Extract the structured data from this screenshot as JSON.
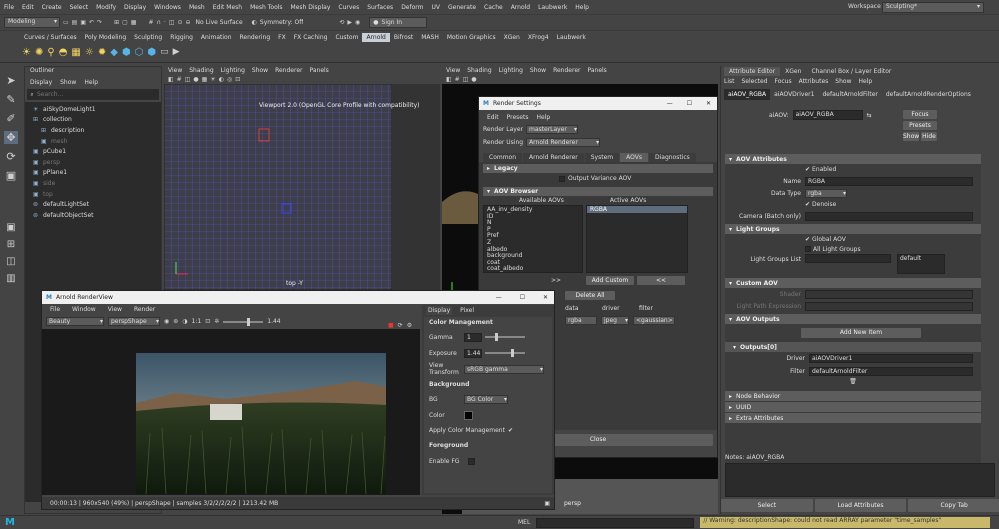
{
  "menubar": {
    "items": [
      "File",
      "Edit",
      "Create",
      "Select",
      "Modify",
      "Display",
      "Windows",
      "Mesh",
      "Edit Mesh",
      "Mesh Tools",
      "Mesh Display",
      "Curves",
      "Surfaces",
      "Deform",
      "UV",
      "Generate",
      "Cache",
      "Arnold",
      "Laubwerk",
      "Help"
    ],
    "workspace_label": "Workspace :",
    "workspace_value": "Sculpting*"
  },
  "statusline": {
    "mode": "Modeling",
    "live_surface": "No Live Surface",
    "symmetry": "Symmetry: Off",
    "sign_in": "Sign In"
  },
  "shelf": {
    "tabs": [
      "Curves / Surfaces",
      "Poly Modeling",
      "Sculpting",
      "Rigging",
      "Animation",
      "Rendering",
      "FX",
      "FX Caching",
      "Custom",
      "Arnold",
      "Bifrost",
      "MASH",
      "Motion Graphics",
      "XGen",
      "XFrog4",
      "Laubwerk"
    ],
    "active": "Arnold"
  },
  "outliner": {
    "title": "Outliner",
    "menus": [
      "Display",
      "Show",
      "Help"
    ],
    "search_placeholder": "Search...",
    "items": [
      {
        "label": "aiSkyDomeLight1",
        "dim": false
      },
      {
        "label": "collection",
        "dim": false
      },
      {
        "label": "description",
        "dim": false
      },
      {
        "label": "mesh",
        "dim": true
      },
      {
        "label": "pCube1",
        "dim": false
      },
      {
        "label": "persp",
        "dim": true
      },
      {
        "label": "pPlane1",
        "dim": false
      },
      {
        "label": "side",
        "dim": true
      },
      {
        "label": "top",
        "dim": true
      },
      {
        "label": "defaultLightSet",
        "dim": false
      },
      {
        "label": "defaultObjectSet",
        "dim": false
      }
    ]
  },
  "viewport_left": {
    "menus": [
      "View",
      "Shading",
      "Lighting",
      "Show",
      "Renderer",
      "Panels"
    ],
    "info": "Viewport 2.0 (OpenGL Core Profile with compatibility)",
    "camera": "top -Y"
  },
  "viewport_right": {
    "menus": [
      "View",
      "Shading",
      "Lighting",
      "Show",
      "Renderer",
      "Panels"
    ],
    "camera": "persp"
  },
  "render_settings": {
    "title": "Render Settings",
    "menus": [
      "Edit",
      "Presets",
      "Help"
    ],
    "render_layer_label": "Render Layer",
    "render_layer_value": "masterLayer",
    "render_using_label": "Render Using",
    "render_using_value": "Arnold Renderer",
    "tabs": [
      "Common",
      "Arnold Renderer",
      "System",
      "AOVs",
      "Diagnostics"
    ],
    "active_tab": "AOVs",
    "legacy": "Legacy",
    "output_variance": "Output Variance AOV",
    "aov_browser": "AOV Browser",
    "available_title": "Available AOVs",
    "active_title": "Active AOVs",
    "available": [
      "AA_inv_density",
      "ID",
      "N",
      "P",
      "Pref",
      "Z",
      "albedo",
      "background",
      "coat",
      "coat_albedo"
    ],
    "active": [
      "RGBA"
    ],
    "add_custom": "Add Custom",
    "remove": "<<",
    "arrows": ">>",
    "delete_all": "Delete All",
    "cols": [
      "data",
      "driver",
      "filter"
    ],
    "row_data": "rgba",
    "row_driver": "jpeg",
    "row_filter": "<gaussian>",
    "close": "Close"
  },
  "renderview": {
    "title": "Arnold RenderView",
    "menus": [
      "File",
      "Window",
      "View",
      "Render"
    ],
    "aov": "Beauty",
    "camera": "perspShape",
    "ratio": "1:1",
    "exposure_value": "1.44",
    "tabs": [
      "Display",
      "Pixel"
    ],
    "status": "00:00:13 | 960x540 (49%) | perspShape | samples 3/2/2/2/2/2 | 1213.42 MB",
    "cm": {
      "section": "Color Management",
      "gamma_label": "Gamma",
      "gamma_value": "1",
      "exposure_label": "Exposure",
      "exposure_value": "1.44",
      "view_transform_label": "View Transform",
      "view_transform_value": "sRGB gamma"
    },
    "bg": {
      "section": "Background",
      "bg_label": "BG",
      "bg_value": "BG Color",
      "color_label": "Color",
      "apply_cm": "Apply Color Management"
    },
    "fg": {
      "section": "Foreground",
      "enable_label": "Enable FG"
    }
  },
  "attr_editor": {
    "title": "Attribute Editor",
    "panel_tabs": [
      "Attribute Editor",
      "XGen",
      "Channel Box / Layer Editor"
    ],
    "menus": [
      "List",
      "Selected",
      "Focus",
      "Attributes",
      "Show",
      "Help"
    ],
    "node_tabs": [
      "aiAOV_RGBA",
      "aiAOVDriver1",
      "defaultArnoldFilter",
      "defaultArnoldRenderOptions"
    ],
    "aiaov_label": "aiAOV:",
    "aiaov_value": "aiAOV_RGBA",
    "focus": "Focus",
    "presets": "Presets",
    "show": "Show",
    "hide": "Hide",
    "sections": {
      "aov_attrs": "AOV Attributes",
      "light_groups": "Light Groups",
      "custom_aov": "Custom AOV",
      "aov_outputs": "AOV Outputs",
      "outputs": "Outputs[0]",
      "node_behavior": "Node Behavior",
      "uuid": "UUID",
      "extra": "Extra Attributes"
    },
    "enabled": "Enabled",
    "name_label": "Name",
    "name_value": "RGBA",
    "data_type_label": "Data Type",
    "data_type_value": "rgba",
    "denoise": "Denoise",
    "camera_label": "Camera (Batch only)",
    "global_aov": "Global AOV",
    "all_light_groups": "All Light Groups",
    "light_groups_list": "Light Groups List",
    "light_groups_default": "default",
    "shader_label": "Shader",
    "light_path_label": "Light Path Expression",
    "add_new_item": "Add New Item",
    "driver_label": "Driver",
    "driver_value": "aiAOVDriver1",
    "filter_label": "Filter",
    "filter_value": "defaultArnoldFilter",
    "notes": "Notes: aiAOV_RGBA",
    "bottom": [
      "Select",
      "Load Attributes",
      "Copy Tab"
    ]
  },
  "bottombar": {
    "mel": "MEL",
    "warning": "// Warning: descriptionShape: could not read ARRAY parameter \"time_samples\""
  },
  "colors": {
    "accent": "#5e6d7d",
    "arnold_tab": "#c9cfd6"
  }
}
